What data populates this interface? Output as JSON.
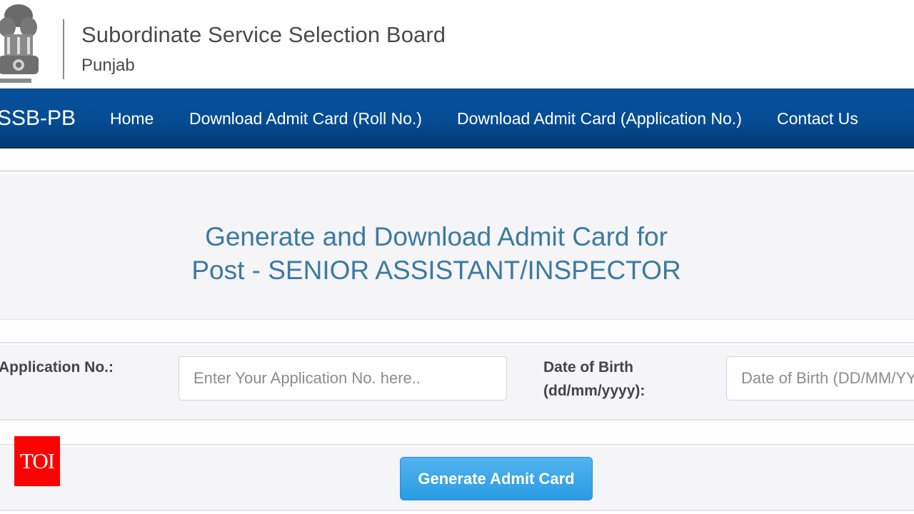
{
  "header": {
    "emblem_icon": "national-emblem-icon",
    "title": "Subordinate Service Selection Board",
    "subtitle": "Punjab"
  },
  "navbar": {
    "brand": "SSB-PB",
    "items": [
      {
        "label": "Home"
      },
      {
        "label": "Download Admit Card (Roll No.)"
      },
      {
        "label": "Download Admit Card (Application No.)"
      },
      {
        "label": "Contact Us"
      }
    ]
  },
  "main": {
    "heading_line1": "Generate and Download Admit Card for",
    "heading_line2": "Post - SENIOR ASSISTANT/INSPECTOR"
  },
  "form": {
    "application_label": "Application No.:",
    "application_placeholder": "Enter Your Application No. here..",
    "application_value": "",
    "dob_label_line1": "Date of Birth",
    "dob_label_line2": "(dd/mm/yyyy):",
    "dob_placeholder": "Date of Birth (DD/MM/YYYY)",
    "dob_value": "",
    "submit_label": "Generate Admit Card"
  },
  "watermark": {
    "label": "TOI",
    "color": "#ff0000"
  },
  "colors": {
    "navbar": "#054c93",
    "heading": "#3a7aa3",
    "button": "#2a9be4"
  }
}
